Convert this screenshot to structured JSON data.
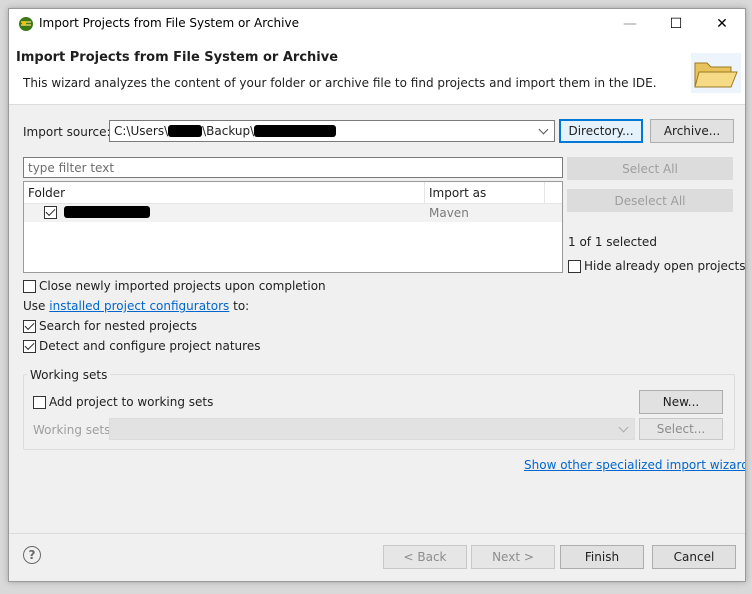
{
  "window": {
    "title": "Import Projects from File System or Archive",
    "minimize": "—",
    "maximize": "☐",
    "close": "✕"
  },
  "header": {
    "title": "Import Projects from File System or Archive",
    "description": "This wizard analyzes the content of your folder or archive file to find projects and import them in the IDE."
  },
  "source": {
    "label": "Import source:",
    "path_prefix": "C:\\Users\\",
    "path_mid": "\\Backup\\",
    "directory_button": "Directory...",
    "archive_button": "Archive..."
  },
  "filter": {
    "placeholder": "type filter text"
  },
  "tree": {
    "columns": [
      "Folder",
      "Import as"
    ],
    "rows": [
      {
        "folder": "",
        "import_as": "Maven",
        "checked": true
      }
    ]
  },
  "side": {
    "select_all": "Select All",
    "deselect_all": "Deselect All",
    "selected_count": "1 of 1 selected",
    "hide_open": "Hide already open projects"
  },
  "options": {
    "close_imported": "Close newly imported projects upon completion",
    "use_prefix": "Use",
    "configurators_link": "installed project configurators",
    "use_suffix": "to:",
    "search_nested": "Search for nested projects",
    "detect_natures": "Detect and configure project natures"
  },
  "working_sets": {
    "group_label": "Working sets",
    "add_to_sets": "Add project to working sets",
    "new_button": "New...",
    "sets_label": "Working sets:",
    "select_button": "Select..."
  },
  "other_wizards_link": "Show other specialized import wizards",
  "footer": {
    "help": "?",
    "back": "< Back",
    "next": "Next >",
    "finish": "Finish",
    "cancel": "Cancel"
  }
}
